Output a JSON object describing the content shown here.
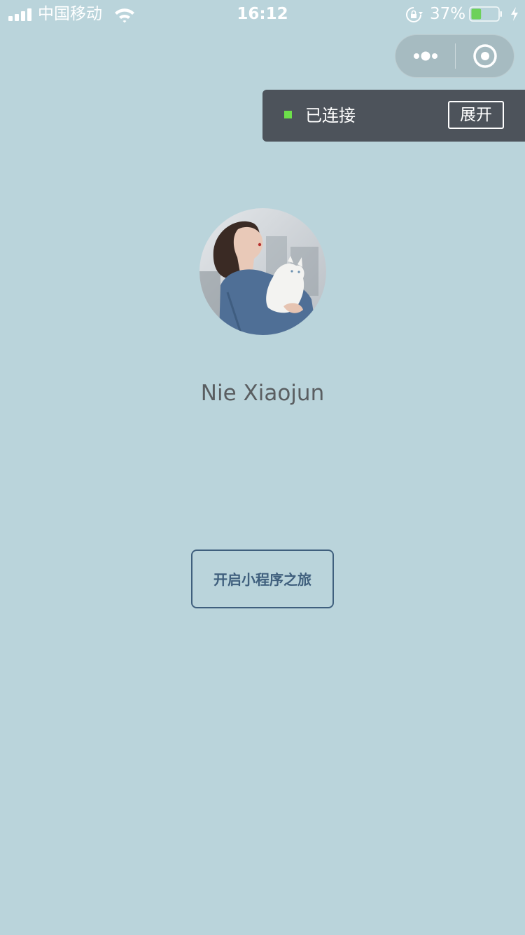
{
  "status_bar": {
    "carrier": "中国移动",
    "time": "16:12",
    "battery_percent": "37%",
    "battery_level": 0.37,
    "icons": [
      "signal-icon",
      "wifi-icon",
      "rotation-lock-icon",
      "battery-icon",
      "charging-icon"
    ]
  },
  "capsule": {
    "icons": [
      "more-icon",
      "close-target-icon"
    ]
  },
  "toast": {
    "status_text": "已连接",
    "expand_label": "展开",
    "status_color": "#6de04a"
  },
  "profile": {
    "nickname": "Nie Xiaojun"
  },
  "main": {
    "start_button_label": "开启小程序之旅"
  },
  "colors": {
    "background": "#bad4db",
    "button_accent": "#3f5f7d",
    "toast_background": "#4d535b"
  }
}
